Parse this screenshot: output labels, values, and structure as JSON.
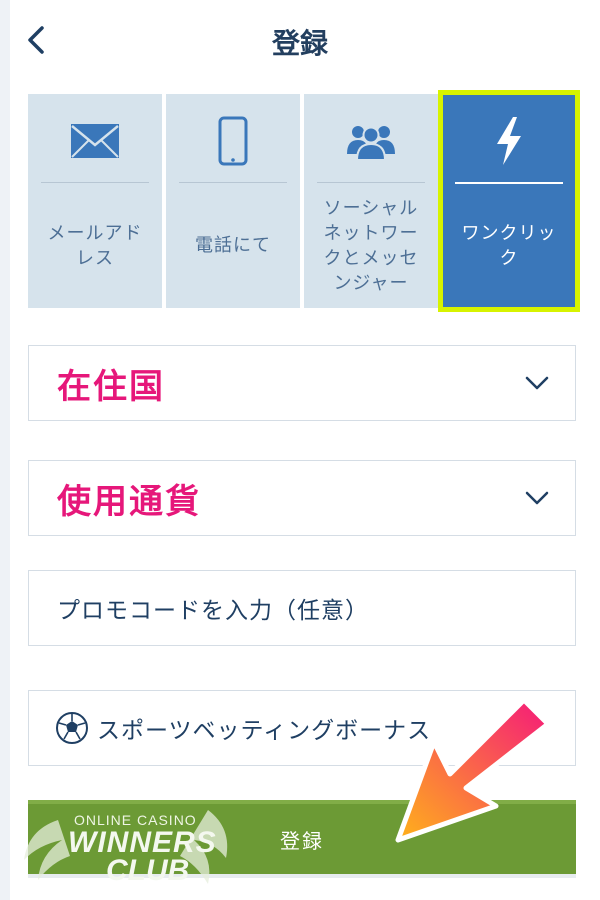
{
  "header": {
    "title": "登録",
    "back_icon": "chevron-left-icon"
  },
  "tabs": [
    {
      "label": "メールアドレス",
      "icon": "envelope-icon",
      "active": false
    },
    {
      "label": "電話にて",
      "icon": "smartphone-icon",
      "active": false
    },
    {
      "label": "ソーシャルネットワークとメッセンジャー",
      "icon": "users-group-icon",
      "active": false
    },
    {
      "label": "ワンクリック",
      "icon": "lightning-icon",
      "active": true
    }
  ],
  "fields": {
    "country": {
      "label": "在住国"
    },
    "currency": {
      "label": "使用通貨"
    },
    "promo": {
      "placeholder": "プロモコードを入力（任意）"
    },
    "bonus": {
      "label": "スポーツベッティングボーナス",
      "icon": "soccer-ball-icon"
    }
  },
  "register_button": {
    "label": "登録"
  },
  "watermark": {
    "line1": "ONLINE CASINO",
    "line2": "WINNERS",
    "line3": "CLUB"
  },
  "colors": {
    "accent": "#3a77ba",
    "highlight": "#d7f300",
    "label_pink": "#e6177a",
    "button_green": "#6c9a35",
    "tab_bg": "#d6e3ec"
  }
}
